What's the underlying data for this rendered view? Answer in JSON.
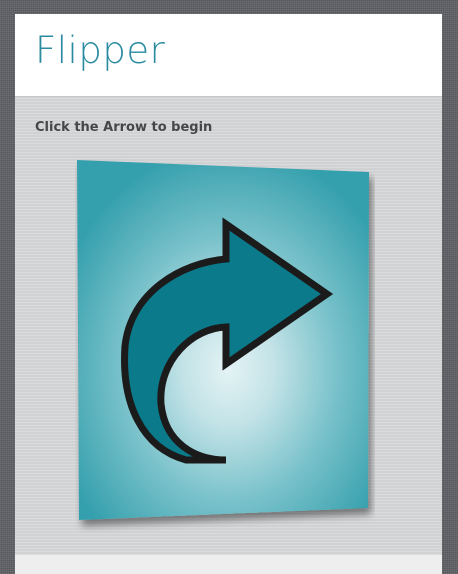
{
  "header": {
    "title": "Flipper"
  },
  "main": {
    "instruction": "Click the Arrow to begin",
    "flip_card": {
      "icon": "curved-arrow-right-icon",
      "colors": {
        "panel_center": "#e4f3f5",
        "panel_edge": "#35a0ad",
        "arrow_fill": "#0b7a8b",
        "arrow_outline": "#1b1b1b"
      }
    }
  },
  "colors": {
    "title": "#2a8ba0",
    "page_background": "#5e6065",
    "content_background": "#d5d6d8"
  }
}
